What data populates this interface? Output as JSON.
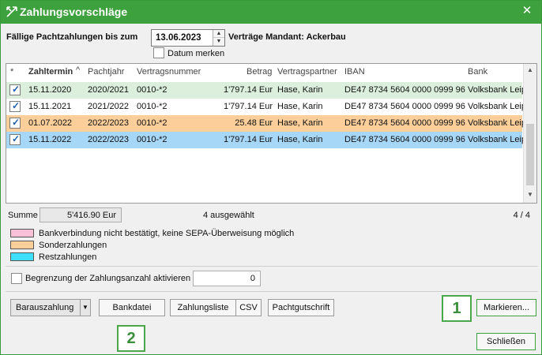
{
  "window": {
    "title": "Zahlungsvorschläge",
    "close_glyph": "✕"
  },
  "filter": {
    "due_label": "Fällige Pachtzahlungen bis zum",
    "date_value": "13.06.2023",
    "contracts_label": "Verträge Mandant: Ackerbau",
    "remember_date_label": "Datum merken"
  },
  "grid": {
    "columns": {
      "star": "*",
      "due_date": "Zahltermin",
      "sort_glyph": "^",
      "lease_year": "Pachtjahr",
      "contract_no": "Vertragsnummer",
      "amount": "Betrag",
      "partner": "Vertragspartner",
      "iban": "IBAN",
      "bank": "Bank"
    },
    "check_glyph": "✓",
    "rows": [
      {
        "due_date": "15.11.2020",
        "lease_year": "2020/2021",
        "contract_no": "0010-*2",
        "amount": "1'797.14 Eur",
        "partner": "Hase, Karin",
        "iban": "DE47 8734 5604 0000 0999 96",
        "bank": "Volksbank Leip"
      },
      {
        "due_date": "15.11.2021",
        "lease_year": "2021/2022",
        "contract_no": "0010-*2",
        "amount": "1'797.14 Eur",
        "partner": "Hase, Karin",
        "iban": "DE47 8734 5604 0000 0999 96",
        "bank": "Volksbank Leip"
      },
      {
        "due_date": "01.07.2022",
        "lease_year": "2022/2023",
        "contract_no": "0010-*2",
        "amount": "25.48 Eur",
        "partner": "Hase, Karin",
        "iban": "DE47 8734 5604 0000 0999 96",
        "bank": "Volksbank Leip"
      },
      {
        "due_date": "15.11.2022",
        "lease_year": "2022/2023",
        "contract_no": "0010-*2",
        "amount": "1'797.14 Eur",
        "partner": "Hase, Karin",
        "iban": "DE47 8734 5604 0000 0999 96",
        "bank": "Volksbank Leip"
      }
    ],
    "row_colors": [
      "#dcefdc",
      "#ffffff",
      "#fccf9a",
      "#a7d7f7"
    ]
  },
  "summary": {
    "sum_label": "Summe",
    "sum_value": "5'416.90 Eur",
    "selected_text": "4 ausgewählt",
    "page_count": "4 / 4"
  },
  "legend": [
    {
      "text": "Bankverbindung nicht bestätigt, keine SEPA-Überweisung möglich",
      "color": "#f9c0d8"
    },
    {
      "text": "Sonderzahlungen",
      "color": "#fccf9a"
    },
    {
      "text": "Restzahlungen",
      "color": "#3fe0ff"
    }
  ],
  "limit": {
    "label": "Begrenzung der Zahlungsanzahl aktivieren",
    "value": "0"
  },
  "actions": {
    "cash_payout": "Barauszahlung",
    "bank_file": "Bankdatei",
    "payment_list": "Zahlungsliste",
    "csv": "CSV",
    "lease_credit": "Pachtgutschrift",
    "mark": "Markieren...",
    "close": "Schließen"
  },
  "badges": {
    "one": "1",
    "two": "2"
  }
}
